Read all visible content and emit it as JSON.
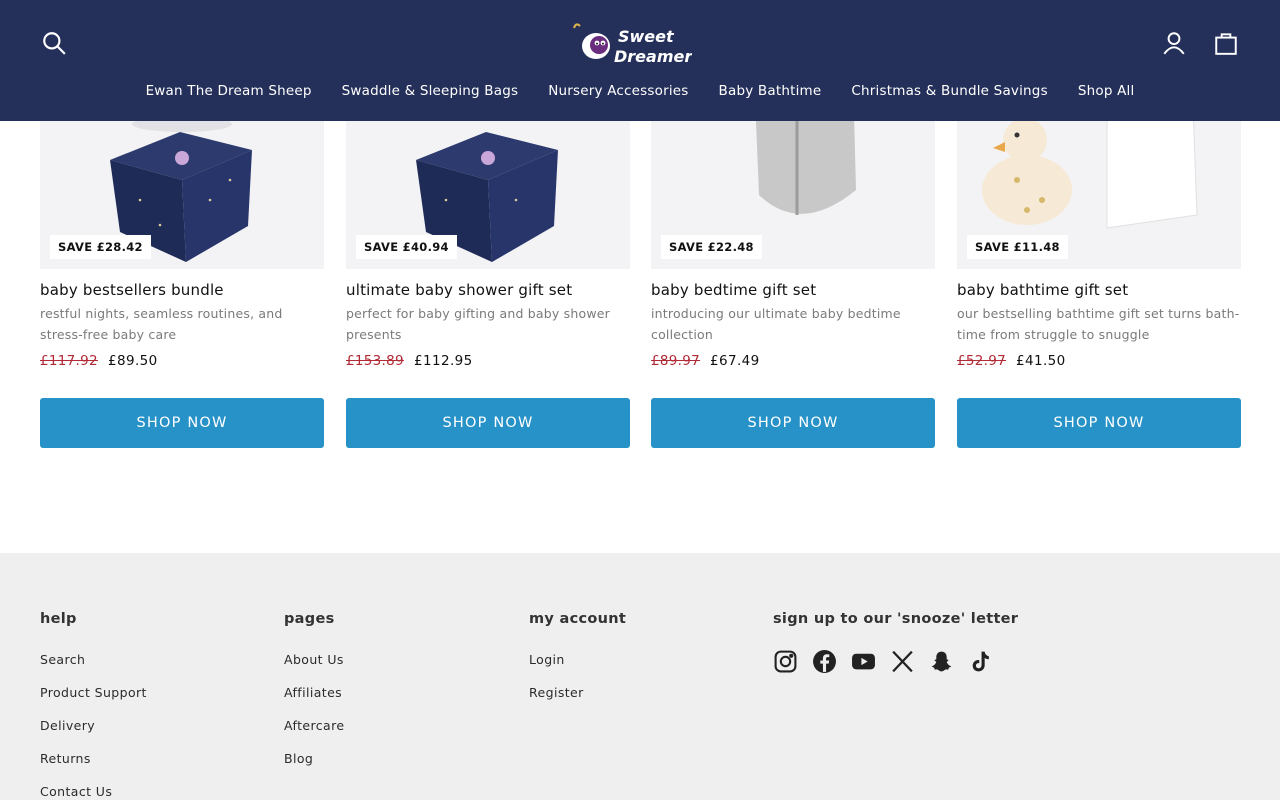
{
  "header": {
    "logo_alt": "Sweet Dreamers",
    "nav": [
      "Ewan The Dream Sheep",
      "Swaddle & Sleeping Bags",
      "Nursery Accessories",
      "Baby Bathtime",
      "Christmas & Bundle Savings",
      "Shop All"
    ],
    "icons": [
      "search-icon",
      "account-icon",
      "cart-icon"
    ]
  },
  "products": [
    {
      "badge": "SAVE £28.42",
      "title": "baby bestsellers bundle",
      "desc": "restful nights, seamless routines, and stress-free baby care",
      "price_old": "£117.92",
      "price_new": "£89.50",
      "button": "SHOP NOW"
    },
    {
      "badge": "SAVE £40.94",
      "title": "ultimate baby shower gift set",
      "desc": "perfect for baby gifting and baby shower presents",
      "price_old": "£153.89",
      "price_new": "£112.95",
      "button": "SHOP NOW"
    },
    {
      "badge": "SAVE £22.48",
      "title": "baby bedtime gift set",
      "desc": "introducing our ultimate baby bedtime collection",
      "price_old": "£89.97",
      "price_new": "£67.49",
      "button": "SHOP NOW"
    },
    {
      "badge": "SAVE £11.48",
      "title": "baby bathtime gift set",
      "desc": "our bestselling bathtime gift set turns bath-time from struggle to snuggle",
      "price_old": "£52.97",
      "price_new": "£41.50",
      "button": "SHOP NOW"
    }
  ],
  "footer": {
    "help": {
      "heading": "help",
      "links": [
        "Search",
        "Product Support",
        "Delivery",
        "Returns",
        "Contact Us"
      ]
    },
    "pages": {
      "heading": "pages",
      "links": [
        "About Us",
        "Affiliates",
        "Aftercare",
        "Blog"
      ]
    },
    "account": {
      "heading": "my account",
      "links": [
        "Login",
        "Register"
      ]
    },
    "newsletter": {
      "heading": "sign up to our 'snooze' letter"
    },
    "social": [
      "instagram-icon",
      "facebook-icon",
      "youtube-icon",
      "x-icon",
      "snapchat-icon",
      "tiktok-icon"
    ]
  },
  "colors": {
    "header_bg": "#25305a",
    "button": "#2692c8",
    "sale_price": "#b22a36",
    "footer_bg": "#efefef"
  }
}
